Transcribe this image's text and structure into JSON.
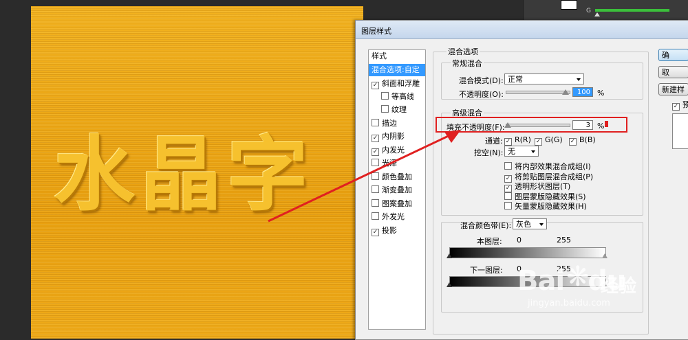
{
  "canvas": {
    "text": "水晶字"
  },
  "right_panel": {
    "channel_label": "G"
  },
  "dialog": {
    "title": "图层样式",
    "style_list": {
      "header": "样式",
      "items": [
        {
          "label": "混合选项:自定",
          "checked": null,
          "selected": true
        },
        {
          "label": "斜面和浮雕",
          "checked": true
        },
        {
          "label": "等高线",
          "checked": false,
          "indent": true
        },
        {
          "label": "纹理",
          "checked": false,
          "indent": true
        },
        {
          "label": "描边",
          "checked": false
        },
        {
          "label": "内阴影",
          "checked": true
        },
        {
          "label": "内发光",
          "checked": true
        },
        {
          "label": "光泽",
          "checked": false
        },
        {
          "label": "颜色叠加",
          "checked": false
        },
        {
          "label": "渐变叠加",
          "checked": false
        },
        {
          "label": "图案叠加",
          "checked": false
        },
        {
          "label": "外发光",
          "checked": false
        },
        {
          "label": "投影",
          "checked": true
        }
      ]
    },
    "blend_options": {
      "section_title": "混合选项",
      "general": {
        "title": "常规混合",
        "mode_label": "混合模式(D):",
        "mode_value": "正常",
        "opacity_label": "不透明度(O):",
        "opacity_value": "100",
        "percent": "%"
      },
      "advanced": {
        "title": "高级混合",
        "fill_label": "填充不透明度(F):",
        "fill_value": "3",
        "percent": "%",
        "channels_label": "通道:",
        "channel_r": "R(R)",
        "channel_g": "G(G)",
        "channel_b": "B(B)",
        "knockout_label": "挖空(N):",
        "knockout_value": "无",
        "options": [
          {
            "label": "将内部效果混合成组(I)",
            "checked": false
          },
          {
            "label": "将剪贴图层混合成组(P)",
            "checked": true
          },
          {
            "label": "透明形状图层(T)",
            "checked": true
          },
          {
            "label": "图层蒙版隐藏效果(S)",
            "checked": false
          },
          {
            "label": "矢量蒙版隐藏效果(H)",
            "checked": false
          }
        ]
      },
      "blend_if": {
        "label": "混合颜色带(E):",
        "value": "灰色",
        "this_layer_label": "本图层:",
        "this_min": "0",
        "this_max": "255",
        "under_layer_label": "下一图层:",
        "under_min": "0",
        "under_max": "255"
      }
    },
    "buttons": {
      "ok": "确",
      "cancel": "取",
      "new_style": "新建样",
      "preview": "预"
    }
  },
  "watermark": {
    "brand": "Bai",
    "brand2": "du",
    "cn": "经验",
    "url": "jingyan.baidu.com"
  }
}
